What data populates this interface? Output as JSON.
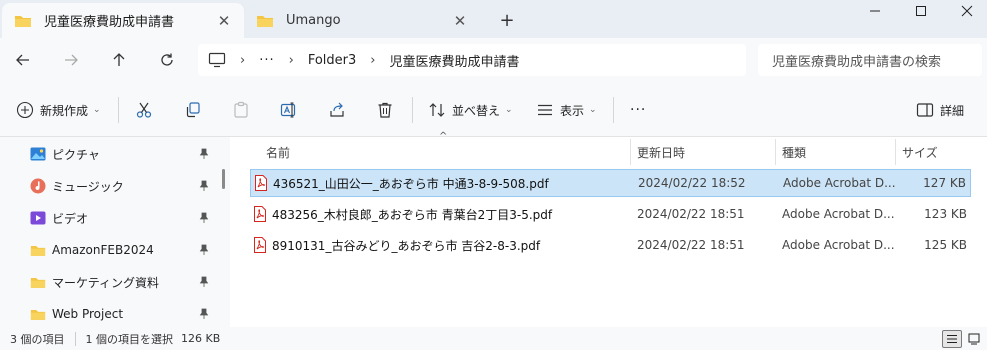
{
  "window": {
    "tabs": [
      {
        "label": "児童医療費助成申請書",
        "active": true
      },
      {
        "label": "Umango",
        "active": false
      }
    ],
    "new_tab": "+",
    "close_tab": "✕"
  },
  "address_bar": {
    "overflow": "···",
    "separator": "›",
    "breadcrumb": [
      "Folder3",
      "児童医療費助成申請書"
    ],
    "search_placeholder": "児童医療費助成申請書の検索"
  },
  "toolbar": {
    "new_label": "新規作成",
    "sort_label": "並べ替え",
    "view_label": "表示",
    "more_label": "···",
    "details_label": "詳細",
    "chevron": "⌄"
  },
  "sidebar": {
    "items": [
      {
        "label": "ピクチャ",
        "icon": "pictures-icon",
        "pinned": true
      },
      {
        "label": "ミュージック",
        "icon": "music-icon",
        "pinned": true
      },
      {
        "label": "ビデオ",
        "icon": "videos-icon",
        "pinned": true
      },
      {
        "label": "AmazonFEB2024",
        "icon": "folder-icon",
        "pinned": true
      },
      {
        "label": "マーケティング資料",
        "icon": "folder-icon",
        "pinned": true
      },
      {
        "label": "Web Project",
        "icon": "folder-icon",
        "pinned": true
      }
    ]
  },
  "file_list": {
    "sort_indicator": "^",
    "columns": [
      "名前",
      "更新日時",
      "種類",
      "サイズ"
    ],
    "rows": [
      {
        "name": "436521_山田公一_あおぞら市 中通3-8-9-508.pdf",
        "date": "2024/02/22 18:52",
        "type": "Adobe Acrobat D...",
        "size": "127 KB",
        "selected": true
      },
      {
        "name": "483256_木村良郎_あおぞら市 青葉台2丁目3-5.pdf",
        "date": "2024/02/22 18:51",
        "type": "Adobe Acrobat D...",
        "size": "123 KB",
        "selected": false
      },
      {
        "name": "8910131_古谷みどり_あおぞら市 吉谷2-8-3.pdf",
        "date": "2024/02/22 18:51",
        "type": "Adobe Acrobat D...",
        "size": "125 KB",
        "selected": false
      }
    ]
  },
  "status_bar": {
    "item_count": "3 個の項目",
    "selection": "1 個の項目を選択",
    "selection_size": "126 KB"
  },
  "colors": {
    "folder": "#f4c542",
    "selection": "#cce4f7",
    "pdf_red": "#d7261e"
  }
}
